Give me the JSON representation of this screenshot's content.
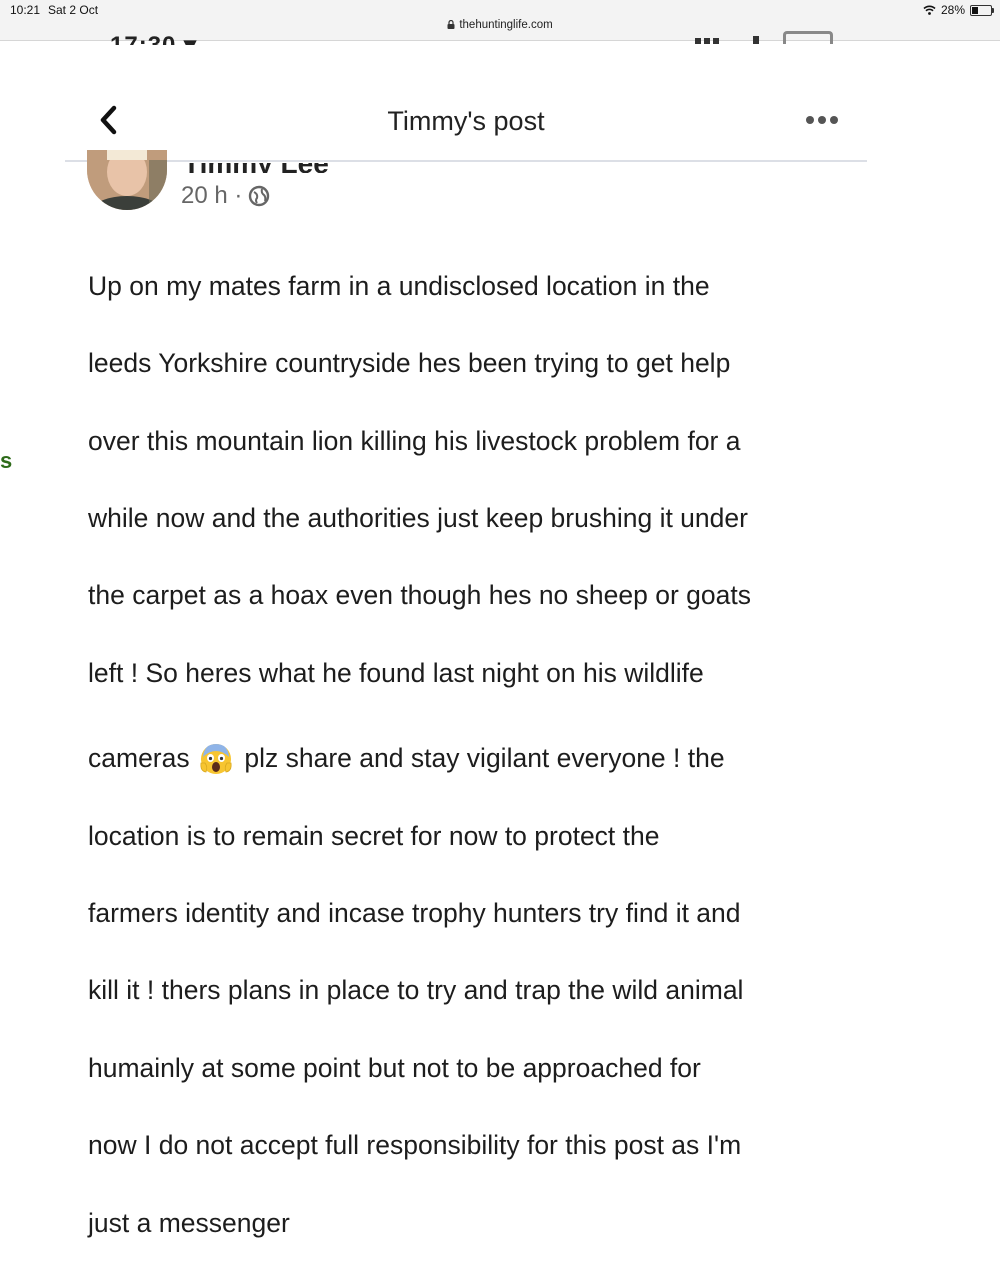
{
  "status_bar": {
    "time": "10:21",
    "date": "Sat 2 Oct",
    "url": "thehuntinglife.com",
    "battery": "28%"
  },
  "post": {
    "title": "Timmy's post",
    "author": "Timmy Lee",
    "age": "20 h ·",
    "lines": [
      "Up on my mates farm in a undisclosed location in the",
      "leeds Yorkshire countryside hes been trying to get help",
      "over this mountain lion killing his livestock problem for a",
      "while now and the authorities just keep brushing it under",
      "the carpet as a hoax even though hes no sheep or goats",
      "left !  So heres what he found last night on his wildlife"
    ],
    "line7_before": "cameras",
    "line7_after": "plz share and stay vigilant everyone ! the",
    "lines_after": [
      "location is to remain secret for now to protect the",
      "farmers identity and incase trophy hunters try find it and",
      "kill it ! thers plans in place to try and trap the wild animal",
      "humainly at some point but not to be approached for",
      "now I do not accept full responsibility for this post as I'm",
      "just a messenger"
    ]
  },
  "side_fragment": "s",
  "colors": {
    "status_bg": "#f3f3f3",
    "meta_gray": "#666666",
    "side_green": "#2e6b1a"
  },
  "icons": [
    "lock-icon",
    "wifi-icon",
    "battery-icon",
    "back-chevron-icon",
    "more-dots-icon",
    "globe-icon",
    "screaming-face-emoji"
  ]
}
